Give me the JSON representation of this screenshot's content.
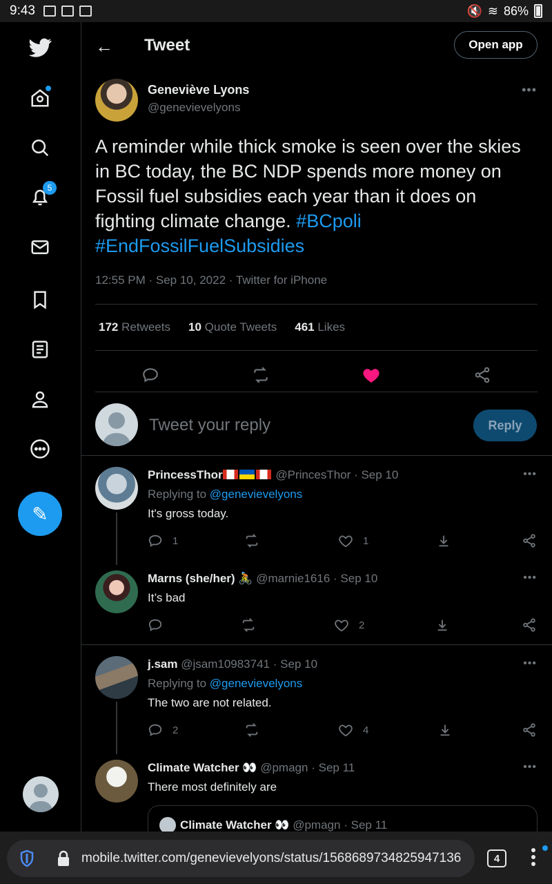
{
  "status_bar": {
    "time": "9:43",
    "battery": "86%"
  },
  "header": {
    "title": "Tweet",
    "open_app": "Open app"
  },
  "sidebar": {
    "notifications_badge": "5"
  },
  "tweet": {
    "author_name": "Geneviève Lyons",
    "author_handle": "@genevievelyons",
    "text": "A reminder while thick smoke is seen over the skies in BC today, the BC NDP spends more money on Fossil fuel subsidies each year than it does on fighting climate change.",
    "hashtags": [
      "#BCpoli",
      "#EndFossilFuelSubsidies"
    ],
    "meta": "12:55 PM · Sep 10, 2022 · Twitter for iPhone",
    "stats": [
      {
        "count": "172",
        "label": "Retweets"
      },
      {
        "count": "10",
        "label": "Quote Tweets"
      },
      {
        "count": "461",
        "label": "Likes"
      }
    ],
    "liked_color": "#f91880"
  },
  "compose_reply": {
    "placeholder": "Tweet your reply",
    "button": "Reply"
  },
  "replies": [
    {
      "name": "PrincessThor",
      "handle": "@PrincesThor",
      "date": "Sep 10",
      "replying_prefix": "Replying to",
      "replying_to": "@genevievelyons",
      "text": "It's gross today.",
      "reply_count": "1",
      "like_count": "1"
    },
    {
      "name": "Marns (she/her)",
      "emoji": "🚴",
      "handle": "@marnie1616",
      "date": "Sep 10",
      "text": "It’s bad",
      "reply_count": "",
      "like_count": "2"
    },
    {
      "name": "j.sam",
      "handle": "@jsam10983741",
      "date": "Sep 10",
      "replying_prefix": "Replying to",
      "replying_to": "@genevievelyons",
      "text": "The two are not related.",
      "reply_count": "2",
      "like_count": "4"
    },
    {
      "name": "Climate Watcher",
      "emoji": "👀",
      "handle": "@pmagn",
      "date": "Sep 11",
      "text": "There most definitely are"
    }
  ],
  "quote": {
    "name": "Climate Watcher",
    "emoji": "👀",
    "handle": "@pmagn",
    "date": "Sep 11"
  },
  "browser": {
    "url": "mobile.twitter.com/genevievelyons/status/1568689734825947136",
    "tab_count": "4"
  }
}
